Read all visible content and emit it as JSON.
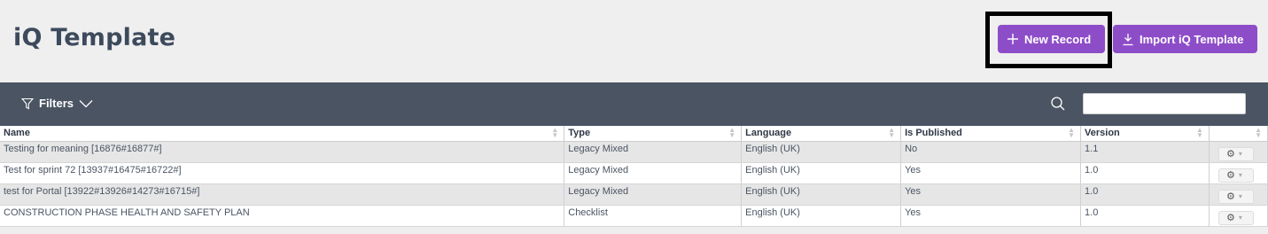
{
  "header": {
    "title": "iQ Template"
  },
  "actions": {
    "new_record": "New Record",
    "import_template": "Import iQ Template"
  },
  "filter_bar": {
    "filters_label": "Filters",
    "search_value": ""
  },
  "colors": {
    "accent": "#8e4dc8",
    "toolbar": "#4a5462",
    "title": "#3d4a5c"
  },
  "table": {
    "columns": [
      "Name",
      "Type",
      "Language",
      "Is Published",
      "Version"
    ],
    "rows": [
      [
        "Testing for meaning [16876#16877#]",
        "Legacy Mixed",
        "English (UK)",
        "No",
        "1.1"
      ],
      [
        "Test for sprint 72 [13937#16475#16722#]",
        "Legacy Mixed",
        "English (UK)",
        "Yes",
        "1.0"
      ],
      [
        "test for Portal [13922#13926#14273#16715#]",
        "Legacy Mixed",
        "English (UK)",
        "Yes",
        "1.0"
      ],
      [
        "CONSTRUCTION PHASE HEALTH AND SAFETY PLAN",
        "Checklist",
        "English (UK)",
        "Yes",
        "1.0"
      ]
    ]
  }
}
